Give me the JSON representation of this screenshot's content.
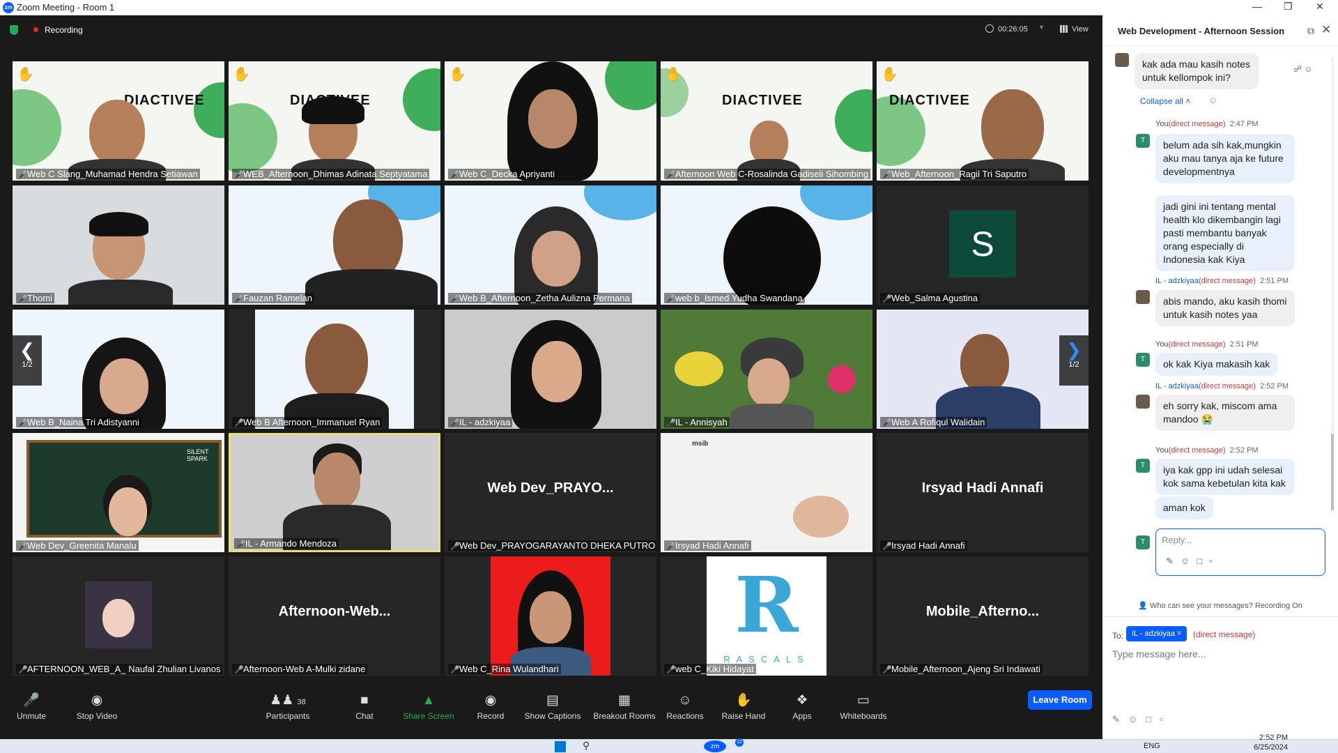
{
  "window": {
    "app_icon": "zm",
    "title": "Zoom Meeting - Room 1"
  },
  "meeting_bar": {
    "recording_label": "Recording",
    "timer": "00:26:05",
    "view_label": "View"
  },
  "tiles": [
    {
      "name": "Web C Slang_Muhamad Hendra Setiawan"
    },
    {
      "name": "WEB_Afternoon_Dhimas Adinata Septyatama"
    },
    {
      "name": "Web C_Decka Apriyanti"
    },
    {
      "name": "Afternoon Web C-Rosalinda Gadiseli Sihombing"
    },
    {
      "name": "Web_Afternoon_Ragil Tri Saputro"
    },
    {
      "name": "Thomi"
    },
    {
      "name": "Fauzan Ramelan"
    },
    {
      "name": "Web B_Afternoon_Zetha Aulizna Permana"
    },
    {
      "name": "web b_Ismed Yudha Swandana"
    },
    {
      "name": "Web_Salma Agustina",
      "initial": "S"
    },
    {
      "name": "Web B_Naina Tri Adistyanni"
    },
    {
      "name": "Web B Afternoon_Immanuel Ryan"
    },
    {
      "name": "IL - adzkiyaa"
    },
    {
      "name": "IL - Annisyah"
    },
    {
      "name": "Web A Rofiqul Walidain"
    },
    {
      "name": "Web Dev_Greenita Manalu"
    },
    {
      "name": "IL - Armando Mendoza"
    },
    {
      "name": "Web Dev_PRAYOGARAYANTO DHEKA PUTRO",
      "display": "Web  Dev_PRAYO..."
    },
    {
      "name": "Irsyad Hadi Annafi"
    },
    {
      "name": "Irsyad Hadi Annafi",
      "display": "Irsyad Hadi Annafi"
    },
    {
      "name": "AFTERNOON_WEB_A_ Naufal Zhulian Livanos"
    },
    {
      "name": "Afternoon-Web A-Mulki zidane",
      "display": "Afternoon-Web..."
    },
    {
      "name": "Web C_Rina Wulandhari"
    },
    {
      "name": "web C_Kiki Hidayat"
    },
    {
      "name": "Mobile_Afternoon_Ajeng Sri Indawati",
      "display": "Mobile_Afterno..."
    }
  ],
  "tile_text": {
    "diactivee": "DIACTIVEE",
    "rascals": "RASCALS",
    "silent_spark": "SILENT SPARK",
    "msib": "msib"
  },
  "pager": {
    "page": "1/2"
  },
  "toolbar": {
    "unmute": "Unmute",
    "stop_video": "Stop Video",
    "participants": "Participants",
    "participants_count": "38",
    "chat": "Chat",
    "share_screen": "Share Screen",
    "record": "Record",
    "show_captions": "Show Captions",
    "breakout_rooms": "Breakout Rooms",
    "reactions": "Reactions",
    "raise_hand": "Raise Hand",
    "apps": "Apps",
    "whiteboards": "Whiteboards",
    "leave": "Leave Room"
  },
  "chat": {
    "title": "Web Development - Afternoon Session",
    "first_msg": "kak ada mau kasih notes untuk kellompok ini?",
    "collapse": "Collapse all",
    "you": "You",
    "dm": "(direct message)",
    "adz": "IL - adzkiyaa",
    "t1": "2:47 PM",
    "t2": "2:51 PM",
    "t3": "2:51 PM",
    "t4": "2:52 PM",
    "t5": "2:52 PM",
    "m1": "belum ada sih kak,mungkin aku mau tanya aja ke future developmentnya",
    "m2": "jadi gini ini tentang mental health klo dikembangin lagi pasti membantu banyak orang especially di Indonesia kak Kiya",
    "m3": "abis mando, aku kasih thomi untuk kasih notes yaa",
    "m4": "ok kak Kiya makasih kak",
    "m5": "eh sorry kak, miscom ama mandoo 😭",
    "m6": "iya kak gpp ini udah selesai kok sama kebetulan kita kak",
    "m7": "aman kok",
    "reply_placeholder": "Reply...",
    "who_can_see": "Who can see your messages? Recording On",
    "to": "To:",
    "to_target": "IL - adzkiyaa",
    "type_placeholder": "Type message here...",
    "avatar_letter": "T"
  },
  "taskbar": {
    "lang": "ENG",
    "time": "2:52 PM",
    "date": "6/25/2024",
    "badge": "12"
  },
  "colors": {
    "accent": "#0b5cff",
    "recording": "#e02828",
    "share_green": "#23a955",
    "dm_red": "#d03737"
  }
}
